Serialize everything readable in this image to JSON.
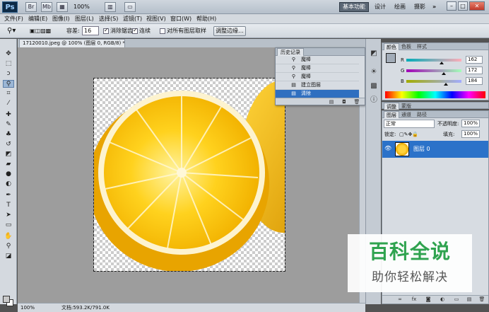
{
  "app": {
    "logo": "Ps",
    "icons": [
      "Br",
      "Mb"
    ],
    "zoom": "100%",
    "workspaces": [
      "基本功能",
      "设计",
      "绘画",
      "摄影"
    ],
    "more": "»",
    "window_buttons": [
      "–",
      "□",
      "✕"
    ]
  },
  "menu": [
    "文件(F)",
    "编辑(E)",
    "图像(I)",
    "图层(L)",
    "选择(S)",
    "滤镜(T)",
    "视图(V)",
    "窗口(W)",
    "帮助(H)"
  ],
  "options": {
    "tolerance_label": "容差:",
    "tolerance_value": "16",
    "antialias_label": "消除锯齿",
    "contiguous_label": "连续",
    "sample_all_label": "对所有图层取样",
    "refine_edge_label": "调整边缘..."
  },
  "document": {
    "tab_title": "17120010.jpeg @ 100% (图层 0, RGB/8) *",
    "zoom_status": "100%",
    "doc_size": "文档:593.2K/791.0K"
  },
  "history": {
    "tab": "历史记录",
    "rows": [
      {
        "label": "魔棒",
        "icon": "magic-wand-icon",
        "glyph": "⚲"
      },
      {
        "label": "魔棒",
        "icon": "magic-wand-icon",
        "glyph": "⚲"
      },
      {
        "label": "魔棒",
        "icon": "magic-wand-icon",
        "glyph": "⚲"
      },
      {
        "label": "建立图层",
        "icon": "new-layer-icon",
        "glyph": "▤"
      },
      {
        "label": "清除",
        "icon": "clear-icon",
        "glyph": "▤"
      }
    ],
    "active_index": 4
  },
  "color_panel": {
    "tabs": [
      "颜色",
      "色板",
      "样式"
    ],
    "r_label": "R",
    "r_value": "162",
    "r": 162,
    "g_label": "G",
    "g_value": "172",
    "g": 172,
    "b_label": "B",
    "b_value": "184",
    "b": 184,
    "fg_color": "#a2acb8"
  },
  "adjust_panel": {
    "tabs": [
      "调整",
      "蒙版"
    ]
  },
  "layers": {
    "tabs": [
      "图层",
      "通道",
      "路径"
    ],
    "blend_mode": "正常",
    "opacity_label": "不透明度:",
    "opacity_value": "100%",
    "lock_label": "锁定:",
    "fill_label": "填充:",
    "fill_value": "100%",
    "layer_name": "图层 0",
    "selected_color": "#2b72c9"
  },
  "watermark": {
    "title": "百科全说",
    "subtitle": "助你轻松解决"
  }
}
